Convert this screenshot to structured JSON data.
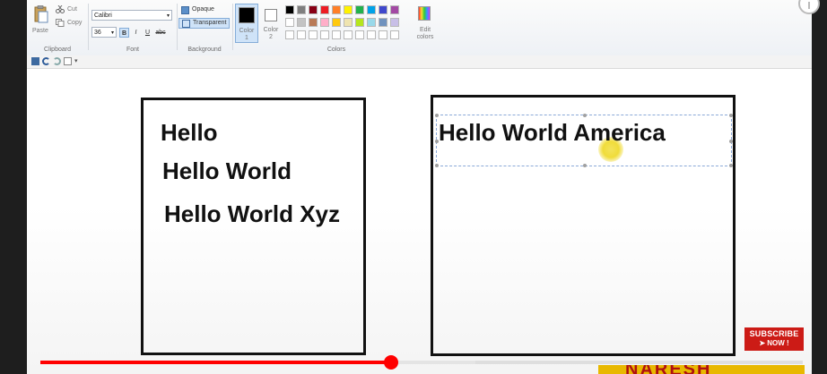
{
  "ribbon": {
    "clipboard": {
      "paste": "Paste",
      "cut": "Cut",
      "copy": "Copy",
      "group": "Clipboard"
    },
    "font": {
      "family": "Calibri",
      "size": "36",
      "bold": "B",
      "italic": "I",
      "underline": "U",
      "strike": "abc",
      "group": "Font"
    },
    "background": {
      "opaque": "Opaque",
      "transparent": "Transparent",
      "group": "Background"
    },
    "colors": {
      "color1": "Color",
      "color1_num": "1",
      "color2": "Color",
      "color2_num": "2",
      "edit": "Edit",
      "edit2": "colors",
      "group": "Colors",
      "palette_row1": [
        "#000000",
        "#7f7f7f",
        "#880015",
        "#ed1c24",
        "#ff7f27",
        "#fff200",
        "#22b14c",
        "#00a2e8",
        "#3f48cc",
        "#a349a4"
      ],
      "palette_row2": [
        "#ffffff",
        "#c3c3c3",
        "#b97a57",
        "#ffaec9",
        "#ffc90e",
        "#efe4b0",
        "#b5e61d",
        "#99d9ea",
        "#7092be",
        "#c8bfe7"
      ]
    }
  },
  "canvas": {
    "left_box_lines": [
      "Hello",
      "Hello World",
      "Hello World Xyz"
    ],
    "right_box_text": "Hello World America"
  },
  "video": {
    "subscribe_line1": "SUBSCRIBE",
    "subscribe_line2": "NOW !",
    "brand": "NARESH",
    "progress_fraction": 0.46
  }
}
